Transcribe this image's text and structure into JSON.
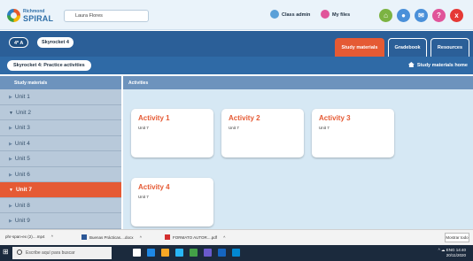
{
  "topbar": {
    "logo_small": "Richmond",
    "logo_big": "SPIRAL",
    "user_name": "Laura Flores",
    "class_admin": "Class admin",
    "my_files": "My files",
    "help_symbol": "?",
    "close_symbol": "x"
  },
  "header": {
    "class_pill": "4º A",
    "book_pill": "Skyrocket 4",
    "tabs": [
      {
        "label": "Study materials",
        "active": true
      },
      {
        "label": "Gradebook",
        "active": false
      },
      {
        "label": "Resources",
        "active": false
      }
    ]
  },
  "subbar": {
    "breadcrumb": "Skyrocket 4: Practice activities",
    "home_link": "Study materials home"
  },
  "sidebar": {
    "heading": "Study materials",
    "units": [
      {
        "label": "Unit 1",
        "arrow": "▶"
      },
      {
        "label": "Unit 2",
        "arrow": "▼"
      },
      {
        "label": "Unit 3",
        "arrow": "▶"
      },
      {
        "label": "Unit 4",
        "arrow": "▶"
      },
      {
        "label": "Unit 5",
        "arrow": "▶"
      },
      {
        "label": "Unit 6",
        "arrow": "▶"
      },
      {
        "label": "Unit 7",
        "arrow": "▼"
      },
      {
        "label": "Unit 8",
        "arrow": "▶"
      },
      {
        "label": "Unit 9",
        "arrow": "▶"
      }
    ]
  },
  "main": {
    "heading": "Activities",
    "cards": [
      {
        "title": "Activity 1",
        "subtitle": "Unit 7"
      },
      {
        "title": "Activity 2",
        "subtitle": "Unit 7"
      },
      {
        "title": "Activity 3",
        "subtitle": "Unit 7"
      },
      {
        "title": "Activity 4",
        "subtitle": "Unit 7"
      }
    ]
  },
  "downloads": {
    "items": [
      {
        "label": "phr-span-ex (2)....mp4",
        "chevron": "^"
      },
      {
        "label": "Buenas Prácticas....docx",
        "chevron": "^"
      },
      {
        "label": "FORMATO AUTOR....pdf",
        "chevron": "^"
      }
    ],
    "show_all": "Mostrar todo"
  },
  "taskbar": {
    "search_placeholder": "Escribe aquí para buscar",
    "tray_text": "^ ☁ ENG",
    "time": "14:40",
    "date": "20/11/2020"
  },
  "colors": {
    "accent_orange": "#e55a34",
    "header_blue": "#2b5f98",
    "panel_blue": "#6d93bd",
    "main_bg": "#d6e8f4"
  }
}
